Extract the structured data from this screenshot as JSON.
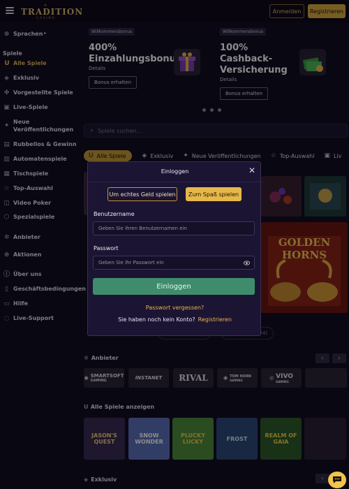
{
  "header": {
    "logo_top": " ",
    "logo_name": "TRADITION",
    "logo_sub": "CASINO",
    "login_label": "Anmelden",
    "register_label": "Registrieren"
  },
  "sidebar": {
    "language": "Sprachen",
    "games_heading": "Spiele",
    "items": [
      {
        "label": "Alle Spiele",
        "icon": "horseshoe-icon"
      },
      {
        "label": "Exklusiv",
        "icon": "shield-icon"
      },
      {
        "label": "Vorgestellte Spiele",
        "icon": "clover-icon"
      },
      {
        "label": "Live-Spiele",
        "icon": "cards-icon"
      },
      {
        "label": "Neue Veröffentlichungen",
        "icon": "new-badge-icon"
      },
      {
        "label": "Rubbellos & Gewinn",
        "icon": "ticket-icon"
      },
      {
        "label": "Automatenspiele",
        "icon": "slot-machine-icon"
      },
      {
        "label": "Tischspiele",
        "icon": "table-icon"
      },
      {
        "label": "Top-Auswahl",
        "icon": "star-icon"
      },
      {
        "label": "Video Poker",
        "icon": "poker-icon"
      },
      {
        "label": "Spezialspiele",
        "icon": "special-icon"
      }
    ],
    "providers": "Anbieter",
    "promotions": "Aktionen",
    "about": "Über uns",
    "terms": "Geschäftsbedingungen",
    "help": "Hilfe",
    "support": "Live-Support"
  },
  "promos": [
    {
      "tag": "Willkommensbonus",
      "title_line1": "400%",
      "title_line2": "Einzahlungsbonus",
      "details": "Details",
      "cta": "Bonus erhalten"
    },
    {
      "tag": "Willkommensbonus",
      "title_line1": "100%",
      "title_line2": "Cashback-",
      "title_line3": "Versicherung",
      "details": "Details",
      "cta": "Bonus erhalten"
    }
  ],
  "search": {
    "placeholder": "Spiele suchen..."
  },
  "category_tabs": [
    {
      "label": "Alle Spiele"
    },
    {
      "label": "Exklusiv"
    },
    {
      "label": "Neue Veröffentlichungen"
    },
    {
      "label": "Top-Auswahl"
    },
    {
      "label": "Liv"
    }
  ],
  "featured": {
    "name_line1": "GOLDEN",
    "name_line2": "HORNS",
    "count_fragment": "324)"
  },
  "sections": {
    "providers_title": "Anbieter",
    "all_games_title": "Alle Spiele anzeigen",
    "exclusive_title": "Exklusiv",
    "prev": "‹",
    "next": "›"
  },
  "providers": [
    {
      "name": "SMARTSOFT",
      "sub": "GAMING"
    },
    {
      "name": "INSTANET",
      "sub": ""
    },
    {
      "name": "RIVAL",
      "sub": ""
    },
    {
      "name": "TOM HORN",
      "sub": "GAMING"
    },
    {
      "name": "VIVO",
      "sub": "GAMING"
    }
  ],
  "games": [
    {
      "name": "JASON'S QUEST",
      "color": "#3a2a52"
    },
    {
      "name": "SNOW WONDER",
      "color": "#5b6fb8"
    },
    {
      "name": "PLUCKY LUCKY",
      "color": "#4d8a3b"
    },
    {
      "name": "FROST",
      "color": "#2c4a78"
    },
    {
      "name": "REALM OF GAIA",
      "color": "#2f5a2a"
    }
  ],
  "modal": {
    "title": "Einloggen",
    "real_money": "Um echtes Geld spielen",
    "for_fun": "Zum Spaß spielen",
    "username_label": "Benutzername",
    "username_placeholder": "Geben Sie Ihren Benutzernamen ein",
    "password_label": "Passwort",
    "password_placeholder": "Geben Sie Ihr Passwort ein",
    "submit": "Einloggen",
    "forgot": "Passwort vergessen?",
    "no_account": "Sie haben noch kein Konto?",
    "register": "Registrieren"
  },
  "colors": {
    "accent": "#e6b848",
    "submit": "#3f8c6c",
    "background": "#120d22"
  }
}
